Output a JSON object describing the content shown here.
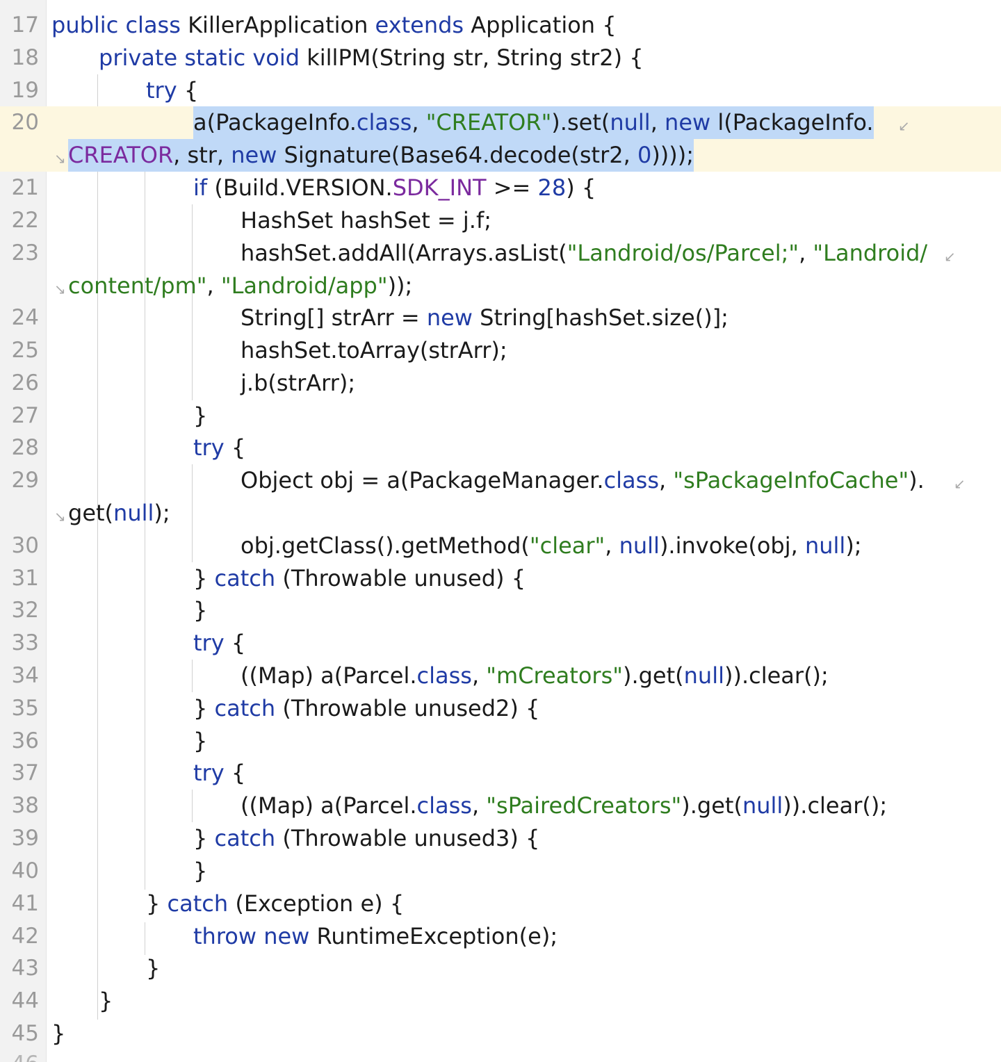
{
  "editor": {
    "fragment_top": "16",
    "fragment_bottom": "46",
    "wrap_out_icon": "↙",
    "wrap_in_icon": "↘",
    "lines": {
      "l17": {
        "num": "17",
        "t": [
          "public",
          " ",
          "class",
          " KillerApplication ",
          "extends",
          " Application {"
        ]
      },
      "l18": {
        "num": "18",
        "t": [
          "private",
          " ",
          "static",
          " ",
          "void",
          " killPM(String str, String str2) {"
        ]
      },
      "l19": {
        "num": "19",
        "t": [
          "try",
          " {"
        ]
      },
      "l20": {
        "num": "20",
        "t": [
          "a(PackageInfo.",
          "class",
          ", ",
          "\"CREATOR\"",
          ").set(",
          "null",
          ", ",
          "new",
          " l(PackageInfo."
        ]
      },
      "l20b": {
        "t": [
          "CREATOR",
          ", str, ",
          "new",
          " Signature(Base64.decode(str2, ",
          "0",
          "))));"
        ]
      },
      "l21": {
        "num": "21",
        "t": [
          "if",
          " (Build.VERSION.",
          "SDK_INT",
          " >= ",
          "28",
          ") {"
        ]
      },
      "l22": {
        "num": "22",
        "t": [
          "HashSet hashSet = j.f;"
        ]
      },
      "l23": {
        "num": "23",
        "t": [
          "hashSet.addAll(Arrays.asList(",
          "\"Landroid/os/Parcel;\"",
          ", ",
          "\"Landroid/"
        ]
      },
      "l23b": {
        "t": [
          "content/pm\"",
          ", ",
          "\"Landroid/app\"",
          "));"
        ]
      },
      "l24": {
        "num": "24",
        "t": [
          "String[] strArr = ",
          "new",
          " String[hashSet.size()];"
        ]
      },
      "l25": {
        "num": "25",
        "t": [
          "hashSet.toArray(strArr);"
        ]
      },
      "l26": {
        "num": "26",
        "t": [
          "j.b(strArr);"
        ]
      },
      "l27": {
        "num": "27",
        "t": [
          "}"
        ]
      },
      "l28": {
        "num": "28",
        "t": [
          "try",
          " {"
        ]
      },
      "l29": {
        "num": "29",
        "t": [
          "Object obj = a(PackageManager.",
          "class",
          ", ",
          "\"sPackageInfoCache\"",
          ")."
        ]
      },
      "l29b": {
        "t": [
          "get(",
          "null",
          ");"
        ]
      },
      "l30": {
        "num": "30",
        "t": [
          "obj.getClass().getMethod(",
          "\"clear\"",
          ", ",
          "null",
          ").invoke(obj, ",
          "null",
          ");"
        ]
      },
      "l31": {
        "num": "31",
        "t": [
          "} ",
          "catch",
          " (Throwable unused) {"
        ]
      },
      "l32": {
        "num": "32",
        "t": [
          "}"
        ]
      },
      "l33": {
        "num": "33",
        "t": [
          "try",
          " {"
        ]
      },
      "l34": {
        "num": "34",
        "t": [
          "((Map) a(Parcel.",
          "class",
          ", ",
          "\"mCreators\"",
          ").get(",
          "null",
          ")).clear();"
        ]
      },
      "l35": {
        "num": "35",
        "t": [
          "} ",
          "catch",
          " (Throwable unused2) {"
        ]
      },
      "l36": {
        "num": "36",
        "t": [
          "}"
        ]
      },
      "l37": {
        "num": "37",
        "t": [
          "try",
          " {"
        ]
      },
      "l38": {
        "num": "38",
        "t": [
          "((Map) a(Parcel.",
          "class",
          ", ",
          "\"sPairedCreators\"",
          ").get(",
          "null",
          ")).clear();"
        ]
      },
      "l39": {
        "num": "39",
        "t": [
          "} ",
          "catch",
          " (Throwable unused3) {"
        ]
      },
      "l40": {
        "num": "40",
        "t": [
          "}"
        ]
      },
      "l41": {
        "num": "41",
        "t": [
          "} ",
          "catch",
          " (Exception e) {"
        ]
      },
      "l42": {
        "num": "42",
        "t": [
          "throw",
          " ",
          "new",
          " RuntimeException(e);"
        ]
      },
      "l43": {
        "num": "43",
        "t": [
          "}"
        ]
      },
      "l44": {
        "num": "44",
        "t": [
          "}"
        ]
      },
      "l45": {
        "num": "45",
        "t": [
          "}"
        ]
      }
    }
  }
}
